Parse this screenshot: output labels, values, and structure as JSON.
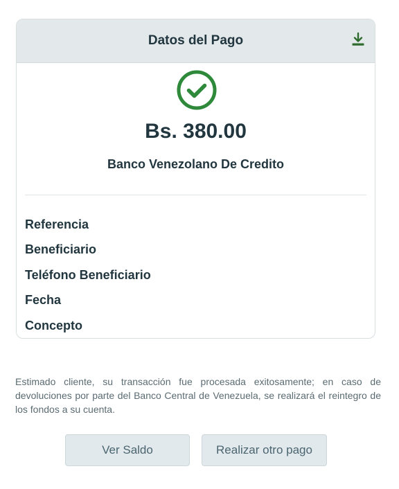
{
  "card": {
    "title": "Datos del Pago",
    "download_icon": "download-icon",
    "status_icon": "check-circle-icon",
    "amount": "Bs. 380.00",
    "bank": "Banco Venezolano De Credito",
    "details": [
      {
        "label": "Referencia",
        "value": ""
      },
      {
        "label": "Beneficiario",
        "value": ""
      },
      {
        "label": "Teléfono Beneficiario",
        "value": ""
      },
      {
        "label": "Fecha",
        "value": ""
      },
      {
        "label": "Concepto",
        "value": ""
      }
    ]
  },
  "notice": "Estimado cliente, su transacción fue procesada exitosamente; en caso de devoluciones por parte del Banco Central de Venezuela, se realizará el reintegro de los fondos a su cuenta.",
  "actions": {
    "ver_saldo": "Ver Saldo",
    "otro_pago": "Realizar otro pago"
  },
  "colors": {
    "success": "#2e8a3a",
    "text": "#21363f",
    "header_bg": "#e3e8ea",
    "button_bg": "#e2e9ec",
    "download_icon": "#2f6b2f"
  }
}
